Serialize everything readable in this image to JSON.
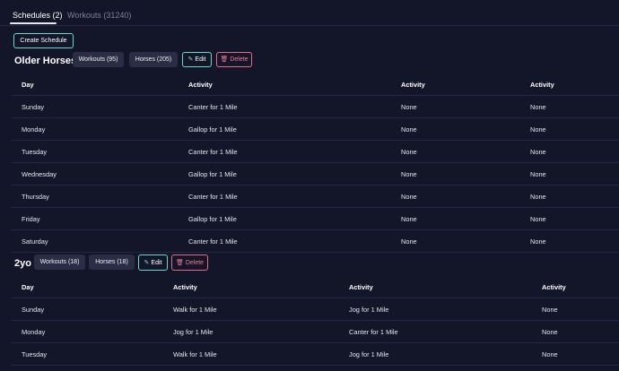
{
  "tabs": {
    "schedules_label": "Schedules (2)",
    "workouts_label": "Workouts (31240)"
  },
  "actions": {
    "create_schedule_label": "Create Schedule"
  },
  "icons": {
    "edit": "pencil-icon",
    "delete": "trash-icon"
  },
  "colors": {
    "background": "#131629",
    "accent_teal": "#69d8c6",
    "danger_red": "#e96b83",
    "chip_bg": "#2a2e45"
  },
  "schedules": [
    {
      "title": "Older Horses",
      "workouts_label": "Workouts (95)",
      "horses_label": "Horses (205)",
      "edit_label": "Edit",
      "delete_label": "Delete",
      "headers": [
        "Day",
        "Activity",
        "Activity",
        "Activity"
      ],
      "rows": [
        [
          "Sunday",
          "Canter for 1 Mile",
          "None",
          "None"
        ],
        [
          "Monday",
          "Gallop for 1 Mile",
          "None",
          "None"
        ],
        [
          "Tuesday",
          "Canter for 1 Mile",
          "None",
          "None"
        ],
        [
          "Wednesday",
          "Gallop for 1 Mile",
          "None",
          "None"
        ],
        [
          "Thursday",
          "Canter for 1 Mile",
          "None",
          "None"
        ],
        [
          "Friday",
          "Gallop for 1 Mile",
          "None",
          "None"
        ],
        [
          "Saturday",
          "Canter for 1 Mile",
          "None",
          "None"
        ]
      ]
    },
    {
      "title": "2yo",
      "workouts_label": "Workouts (18)",
      "horses_label": "Horses (18)",
      "edit_label": "Edit",
      "delete_label": "Delete",
      "headers": [
        "Day",
        "Activity",
        "Activity",
        "Activity"
      ],
      "rows": [
        [
          "Sunday",
          "Walk for 1 Mile",
          "Jog for 1 Mile",
          "None"
        ],
        [
          "Monday",
          "Jog for 1 Mile",
          "Canter for 1 Mile",
          "None"
        ],
        [
          "Tuesday",
          "Walk for 1 Mile",
          "Jog for 1 Mile",
          "None"
        ]
      ]
    }
  ]
}
